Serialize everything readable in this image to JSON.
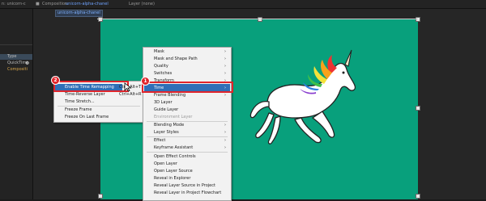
{
  "topbar": {
    "left_label": "n: unicorn-c",
    "composition_prefix": "Composition",
    "composition_name": "unicorn-alpha-chanel",
    "layer_label": "Layer (none)",
    "comp_tab": "unicorn-alpha-chanel"
  },
  "left_panel": {
    "rows": [
      "Type",
      "QuickTime",
      "Compositi"
    ]
  },
  "time_submenu": {
    "items": [
      {
        "label": "Enable Time Remapping",
        "shortcut": "Ctrl+Alt+T"
      },
      {
        "label": "Time-Reverse Layer",
        "shortcut": "Ctrl+Alt+R"
      },
      {
        "label": "Time Stretch...",
        "shortcut": ""
      },
      {
        "label": "Freeze Frame",
        "shortcut": ""
      },
      {
        "label": "Freeze On Last Frame",
        "shortcut": ""
      }
    ]
  },
  "context_menu": {
    "items": [
      {
        "label": "Mask",
        "sub": true
      },
      {
        "label": "Mask and Shape Path",
        "sub": true
      },
      {
        "label": "Quality",
        "sub": true
      },
      {
        "label": "Switches",
        "sub": true
      },
      {
        "label": "Transform",
        "sub": true
      },
      {
        "label": "Time",
        "sub": true
      },
      {
        "label": "Frame Blending",
        "sub": true
      },
      {
        "label": "3D Layer",
        "sub": false
      },
      {
        "label": "Guide Layer",
        "sub": false
      },
      {
        "label": "Environment Layer",
        "sub": false,
        "dim": true
      },
      {
        "label": "Blending Mode",
        "sub": true
      },
      {
        "label": "Layer Styles",
        "sub": true
      },
      {
        "label": "Effect",
        "sub": true
      },
      {
        "label": "Keyframe Assistant",
        "sub": true
      },
      {
        "label": "Open Effect Controls",
        "sub": false
      },
      {
        "label": "Open Layer",
        "sub": false
      },
      {
        "label": "Open Layer Source",
        "sub": false
      },
      {
        "label": "Reveal in Explorer",
        "sub": false
      },
      {
        "label": "Reveal Layer Source in Project",
        "sub": false
      },
      {
        "label": "Reveal Layer in Project Flowchart",
        "sub": false
      }
    ]
  },
  "badges": {
    "first": "1",
    "second": "2"
  },
  "colors": {
    "stage": "#08a07c",
    "highlight": "#2f6fb7",
    "annotation": "#e0242b"
  }
}
